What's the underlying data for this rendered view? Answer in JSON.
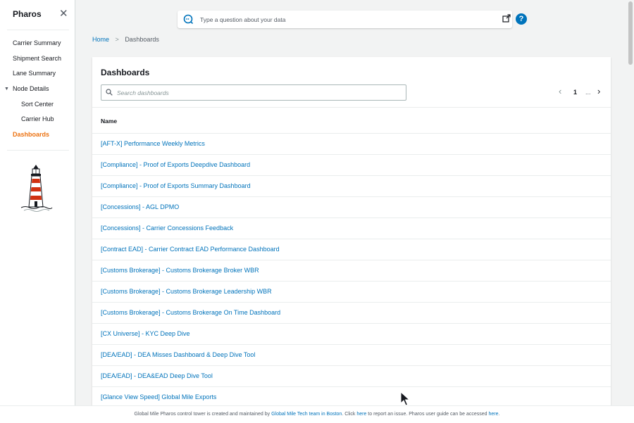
{
  "sidebar": {
    "title": "Pharos",
    "close_glyph": "✕",
    "items": [
      {
        "label": "Carrier Summary"
      },
      {
        "label": "Shipment Search"
      },
      {
        "label": "Lane Summary"
      },
      {
        "label": "Node Details"
      },
      {
        "label": "Sort Center"
      },
      {
        "label": "Carrier Hub"
      },
      {
        "label": "Dashboards"
      }
    ],
    "active_color": "#ec7211"
  },
  "ask_bar": {
    "placeholder": "Type a question about your data"
  },
  "help": {
    "glyph": "?"
  },
  "breadcrumb": {
    "home": "Home",
    "current": "Dashboards"
  },
  "panel": {
    "title": "Dashboards",
    "search_placeholder": "Search dashboards",
    "pagination": {
      "prev": "‹",
      "page": "1",
      "ellipsis": "...",
      "next": "›"
    },
    "column_name": "Name",
    "rows": [
      "[AFT-X] Performance Weekly Metrics",
      "[Compliance] - Proof of Exports Deepdive Dashboard",
      "[Compliance] - Proof of Exports Summary Dashboard",
      "[Concessions] - AGL DPMO",
      "[Concessions] - Carrier Concessions Feedback",
      "[Contract EAD] - Carrier Contract EAD Performance Dashboard",
      "[Customs Brokerage] - Customs Brokerage Broker WBR",
      "[Customs Brokerage] - Customs Brokerage Leadership WBR",
      "[Customs Brokerage] - Customs Brokerage On Time Dashboard",
      "[CX Universe] - KYC Deep Dive",
      "[DEA/EAD] - DEA Misses Dashboard & Deep Dive Tool",
      "[DEA/EAD] - DEA&EAD Deep Dive Tool",
      "[Glance View Speed] Global Mile Exports"
    ]
  },
  "footer": {
    "part1": "Global Mile Pharos control tower is created and maintained by ",
    "link1": "Global Mile Tech team in Boston",
    "part2": ". Click ",
    "link2": "here",
    "part3": " to report an issue. Pharos user guide can be accessed ",
    "link3": "here",
    "part4": "."
  },
  "colors": {
    "link": "#0073bb",
    "accent": "#ec7211",
    "background": "#f2f3f3"
  }
}
